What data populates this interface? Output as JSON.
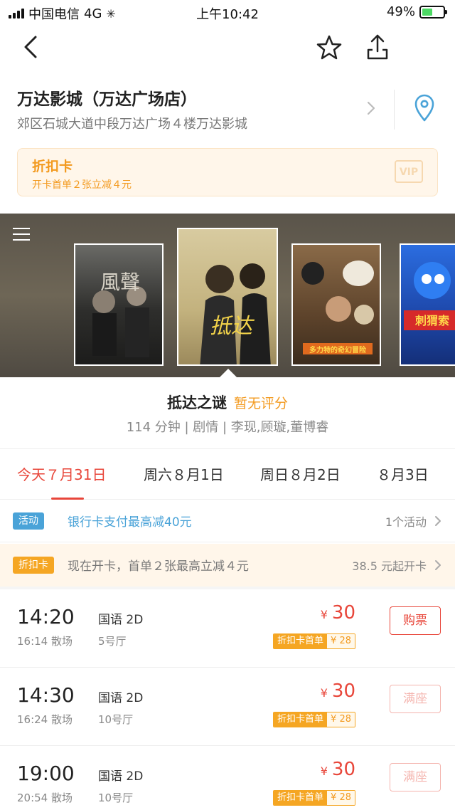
{
  "status_bar": {
    "carrier": "中国电信",
    "network": "4G",
    "time": "上午10:42",
    "battery": "49%",
    "battery_level": 0.49
  },
  "cinema": {
    "name": "万达影城（万达广场店）",
    "address": "郊区石城大道中段万达广场４楼万达影城"
  },
  "discount_card": {
    "title": "折扣卡",
    "subtitle": "开卡首单２张立减４元",
    "badge": "VIP"
  },
  "posters": [
    {
      "title": "風聲",
      "color": "#3b3b3b"
    },
    {
      "title": "抵达之谜",
      "color": "#c9b98a"
    },
    {
      "title": "多力特的奇幻冒险",
      "color": "#6b4a2c"
    },
    {
      "title": "刺猬索尼克",
      "color": "#1f4fb0"
    }
  ],
  "movie": {
    "name": "抵达之谜",
    "score": "暂无评分",
    "meta": "114 分钟 | 剧情 | 李现,顾璇,董博睿"
  },
  "date_tabs": [
    {
      "label": "今天７月31日",
      "active": true
    },
    {
      "label": "周六８月1日",
      "active": false
    },
    {
      "label": "周日８月2日",
      "active": false
    },
    {
      "label": "８月3日",
      "active": false
    }
  ],
  "promos": {
    "activity": {
      "tag": "活动",
      "text": "银行卡支付最高减40元",
      "right": "1个活动"
    },
    "card": {
      "tag": "折扣卡",
      "text": "现在开卡，首单２张最高立减４元",
      "right": "38.5 元起开卡"
    }
  },
  "showtimes": [
    {
      "time": "14:20",
      "end": "16:14 散场",
      "lang": "国语 2D",
      "hall": "5号厅",
      "currency": "¥",
      "price": "30",
      "disc_label": "折扣卡首单",
      "disc_price": "¥ 28",
      "button": "购票",
      "full": false
    },
    {
      "time": "14:30",
      "end": "16:24 散场",
      "lang": "国语 2D",
      "hall": "10号厅",
      "currency": "¥",
      "price": "30",
      "disc_label": "折扣卡首单",
      "disc_price": "¥ 28",
      "button": "满座",
      "full": true
    },
    {
      "time": "19:00",
      "end": "20:54 散场",
      "lang": "国语 2D",
      "hall": "10号厅",
      "currency": "¥",
      "price": "30",
      "disc_label": "折扣卡首单",
      "disc_price": "¥ 28",
      "button": "满座",
      "full": true
    }
  ],
  "colors": {
    "accent": "#e8463a",
    "orange": "#f39a1f",
    "activity_blue": "#4aa3d8"
  }
}
